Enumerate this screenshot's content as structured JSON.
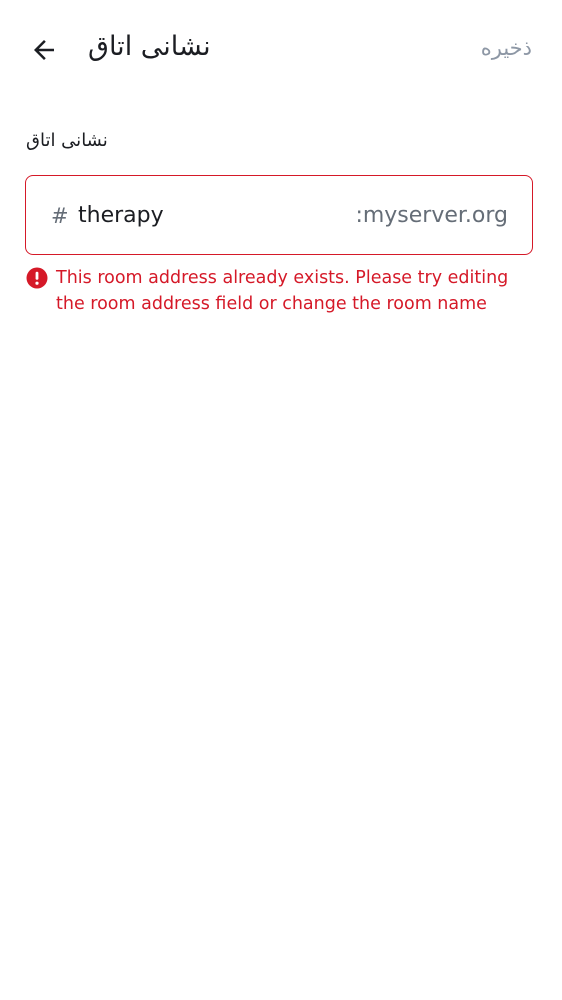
{
  "header": {
    "title": "نشانی اتاق",
    "save_label": "ذخیره"
  },
  "address_field": {
    "label": "نشانی اتاق",
    "prefix": "#",
    "value": "therapy",
    "suffix": ":myserver.org"
  },
  "error": {
    "message": "This room address already exists. Please try editing the room address field or change the room name"
  },
  "colors": {
    "error": "#d51928",
    "text_primary": "#1b1d22",
    "text_secondary": "#656d77",
    "disabled": "#8d97a5"
  },
  "icons": {
    "back": "arrow-left-icon",
    "error": "error-circle-icon"
  }
}
